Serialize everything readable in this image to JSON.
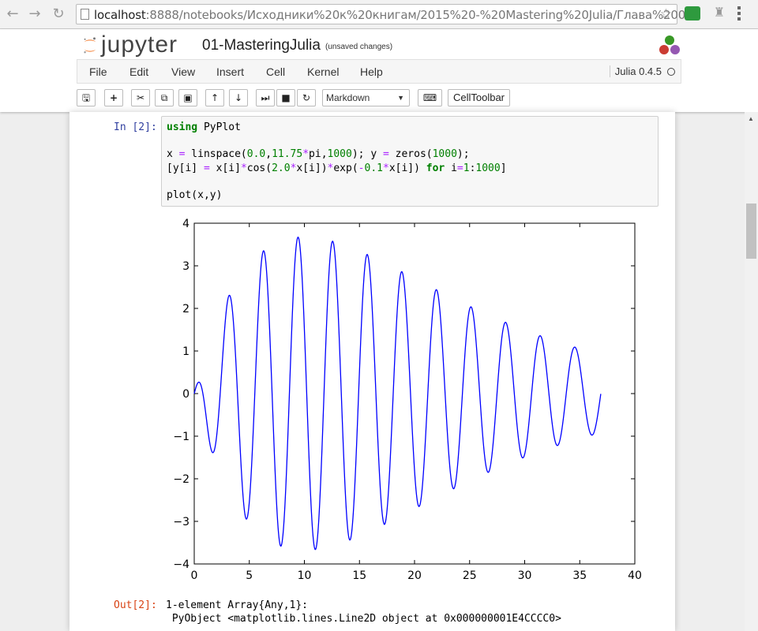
{
  "browser": {
    "url_host": "localhost",
    "url_rest": ":8888/notebooks/Исходники%20к%20книгам/2015%20-%20Mastering%20Julia/Глава%200"
  },
  "header": {
    "logo_text": "jupyter",
    "notebook_title": "01-MasteringJulia",
    "save_status": "(unsaved changes)"
  },
  "menubar": {
    "items": [
      "File",
      "Edit",
      "View",
      "Insert",
      "Cell",
      "Kernel",
      "Help"
    ],
    "kernel_name": "Julia 0.4.5"
  },
  "toolbar": {
    "cell_type": "Markdown",
    "celltoolbar_label": "CellToolbar"
  },
  "cell": {
    "in_prompt": "In [2]:",
    "code_lines": [
      "using PyPlot",
      "",
      "x = linspace(0.0,11.75*pi,1000); y = zeros(1000);",
      "[y[i] = x[i]*cos(2.0*x[i])*exp(-0.1*x[i]) for i=1:1000]",
      "",
      "plot(x,y)"
    ],
    "out_prompt": "Out[2]:",
    "output_lines": [
      "1-element Array{Any,1}:",
      " PyObject <matplotlib.lines.Line2D object at 0x000000001E4CCCC0>"
    ]
  },
  "chart_data": {
    "type": "line",
    "formula": "y = x*cos(2x)*exp(-0.1x)",
    "x_range": [
      0,
      36.91
    ],
    "n_points": 1000,
    "xlim": [
      0,
      40
    ],
    "ylim": [
      -4,
      4
    ],
    "xticks": [
      "0",
      "5",
      "10",
      "15",
      "20",
      "25",
      "30",
      "35",
      "40"
    ],
    "yticks": [
      "4",
      "3",
      "2",
      "1",
      "0",
      "−1",
      "−2",
      "−3",
      "−4"
    ],
    "line_color": "#0000ff",
    "grid": false
  },
  "colors": {
    "in_prompt": "#303f9f",
    "out_prompt": "#d84315",
    "keyword": "#008000"
  }
}
